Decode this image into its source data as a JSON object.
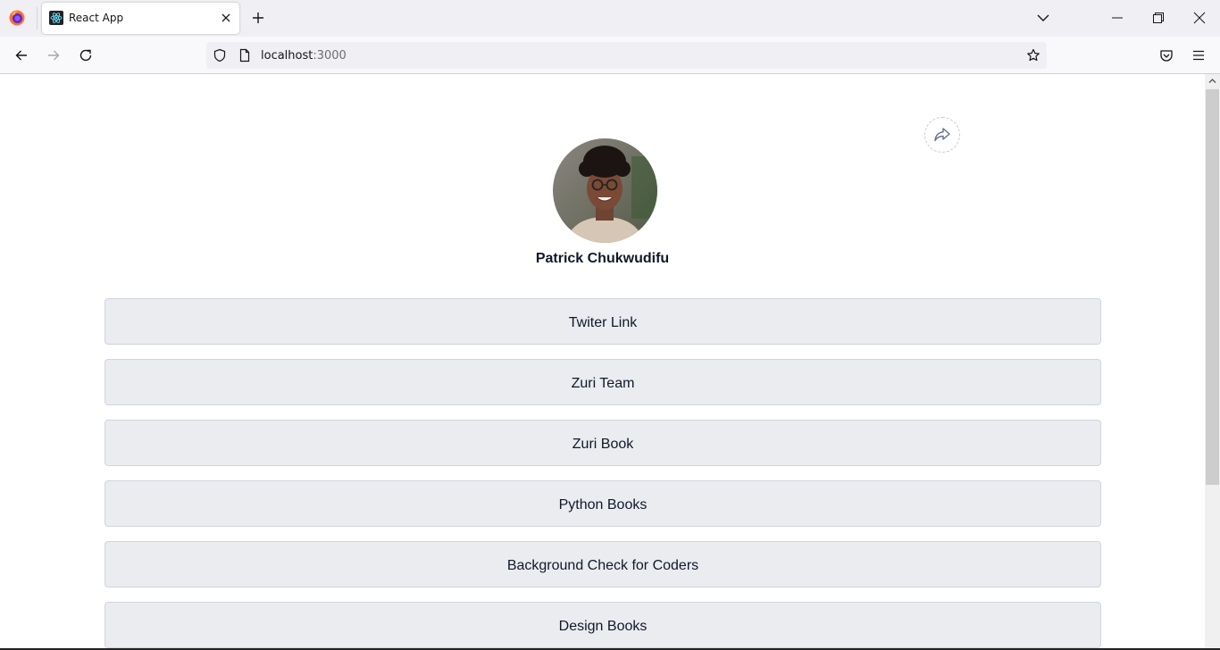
{
  "browser": {
    "tab_title": "React App",
    "url_host": "localhost",
    "url_port": ":3000"
  },
  "profile": {
    "name": "Patrick Chukwudifu"
  },
  "links": [
    {
      "label": "Twiter Link"
    },
    {
      "label": "Zuri Team"
    },
    {
      "label": "Zuri Book"
    },
    {
      "label": "Python Books"
    },
    {
      "label": "Background Check for Coders"
    },
    {
      "label": "Design Books"
    }
  ],
  "colors": {
    "link_bg": "#eaecf0",
    "link_border": "#d0d5dd",
    "text": "#101828"
  },
  "icons": {
    "share": "share-arrow-icon",
    "avatar": "profile-photo"
  }
}
